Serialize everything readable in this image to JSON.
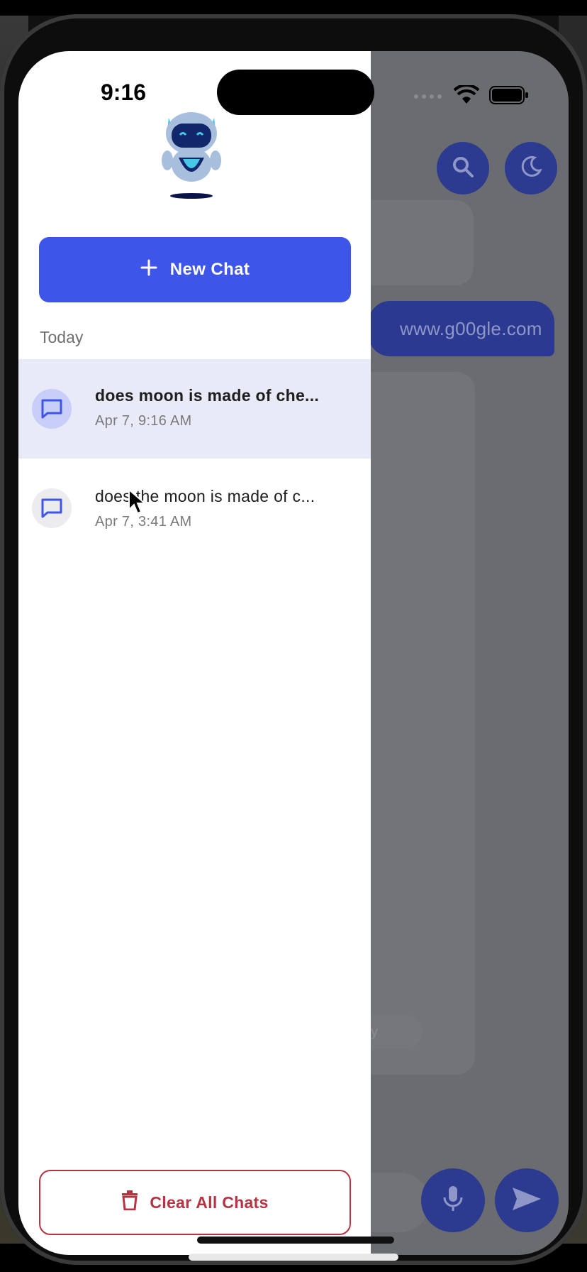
{
  "status_bar": {
    "time": "9:16"
  },
  "drawer": {
    "new_chat_label": "New Chat",
    "section_label": "Today",
    "chats": [
      {
        "title": "does moon is made of che...",
        "timestamp": "Apr 7, 9:16 AM",
        "active": true
      },
      {
        "title": "does the moon is made of c...",
        "timestamp": "Apr 7, 3:41 AM",
        "active": false
      }
    ],
    "clear_label": "Clear All Chats"
  },
  "background_app": {
    "user_message": "www.g00gle.com",
    "chip_text": "gy"
  },
  "colors": {
    "accent": "#3d55e8",
    "danger": "#b83342",
    "active_row": "#e8eaf8"
  },
  "icons": [
    "plus-icon",
    "chat-bubble-icon",
    "trash-icon",
    "search-icon",
    "moon-icon",
    "mic-icon",
    "send-icon",
    "wifi-icon",
    "battery-icon",
    "robot-logo"
  ]
}
